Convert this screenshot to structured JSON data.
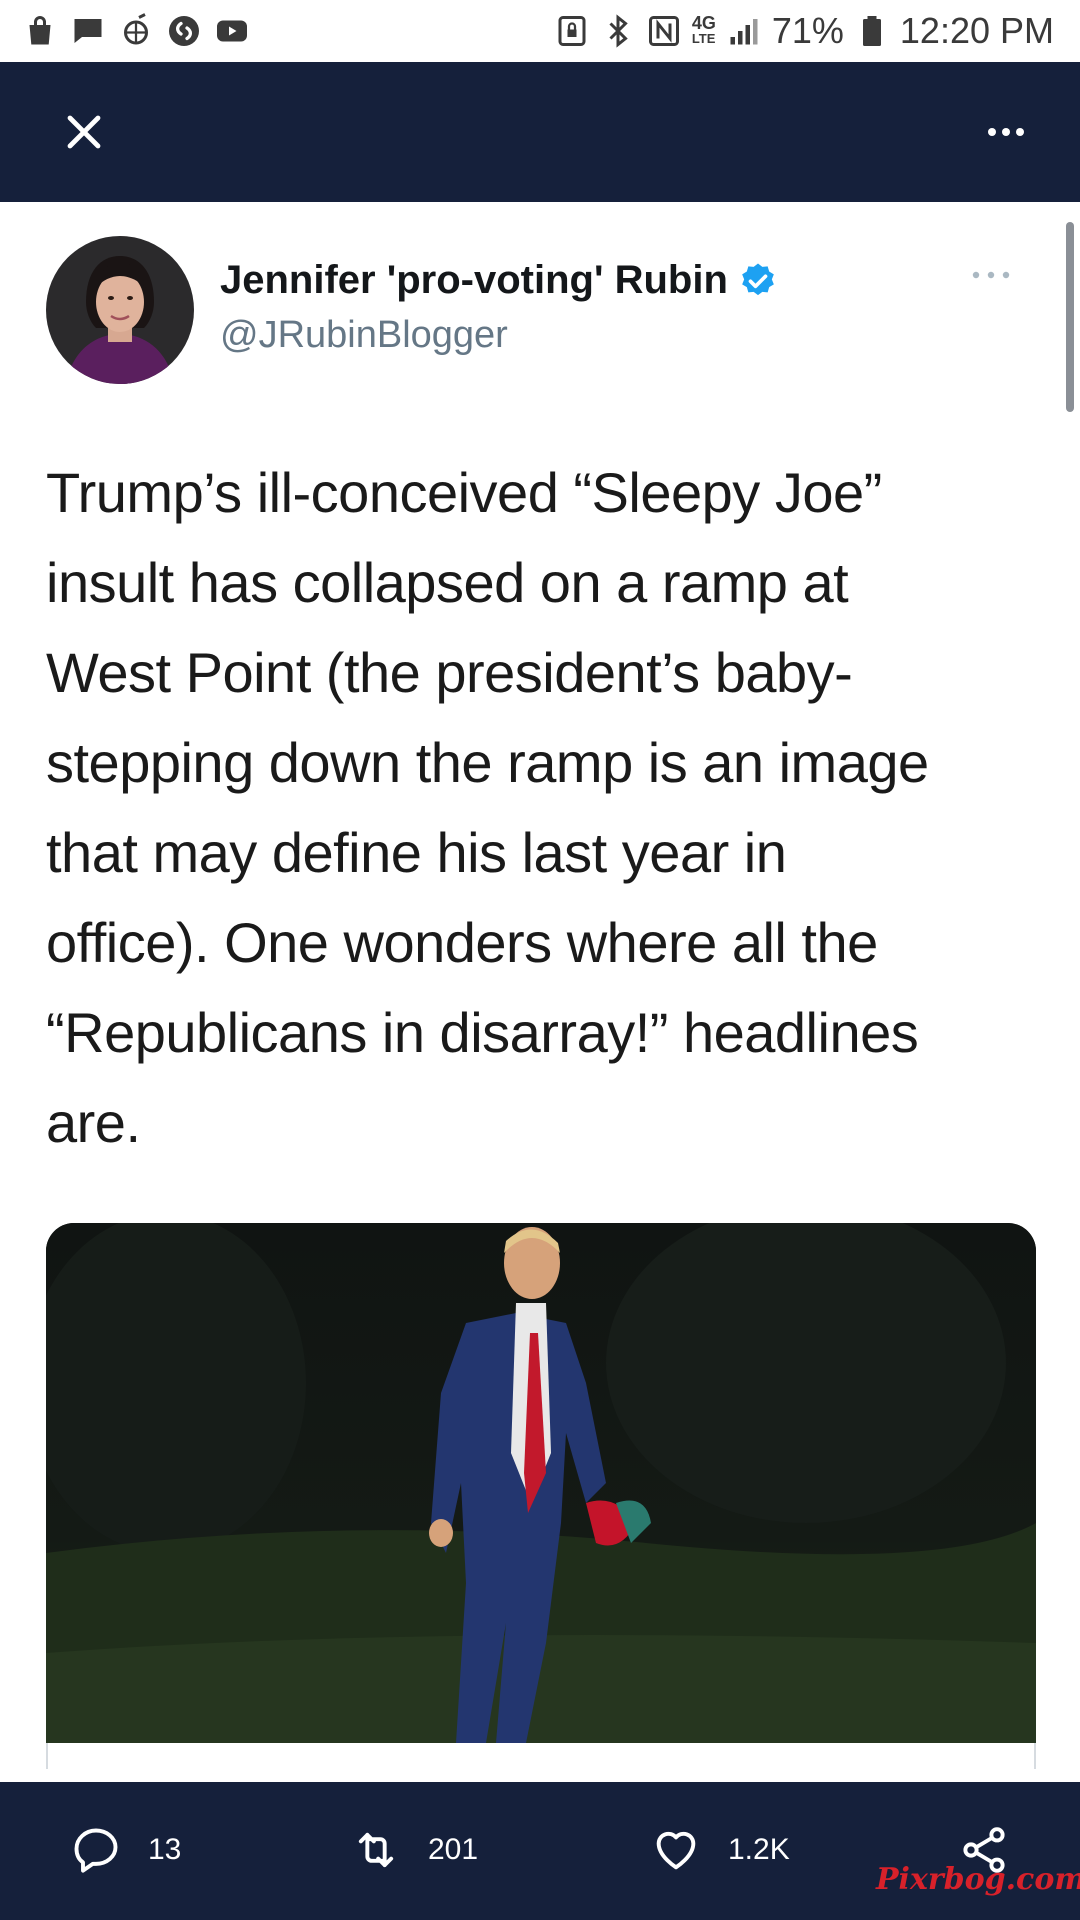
{
  "status_bar": {
    "icons_left": [
      "shopping-bag-icon",
      "chat-bubble-icon",
      "sports-logo-icon",
      "shazam-icon",
      "youtube-icon"
    ],
    "icons_right": [
      "nfc-lock-icon",
      "bluetooth-icon",
      "nfc-icon",
      "lte-icon",
      "signal-icon",
      "battery-icon"
    ],
    "network": "4G",
    "network_sub": "LTE",
    "battery": "71%",
    "time": "12:20 PM"
  },
  "header": {
    "close_icon": "close-icon",
    "more_icon": "more-horizontal-icon",
    "background": "#15203b"
  },
  "tweet": {
    "author_name": "Jennifer 'pro-voting' Rubin",
    "author_handle": "@JRubinBlogger",
    "verified": true,
    "verified_color": "#1da1f2",
    "text": "Trump’s ill-conceived “Sleepy Joe”\ninsult has collapsed on a ramp at\nWest Point (the president’s baby-\nstepping down the ramp is an image\nthat may define his last year in\noffice). One wonders where all the\n“Republicans in disarray!” headlines\nare."
  },
  "actions": {
    "reply_count": "13",
    "retweet_count": "201",
    "like_count": "1.2K",
    "share_icon": "share-icon"
  },
  "watermark": "Pixrbog.com"
}
